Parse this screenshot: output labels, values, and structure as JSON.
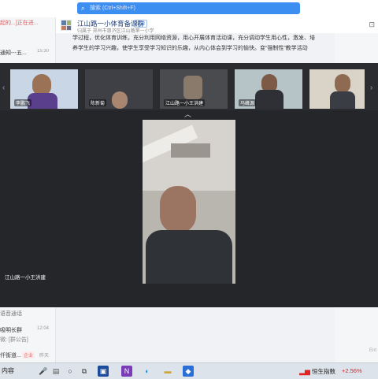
{
  "search": {
    "placeholder": "搜索 (Ctrl+Shift+F)",
    "icon": "search-icon"
  },
  "sidebar": {
    "items": [
      {
        "label": "起的...]正在进...",
        "time": "",
        "color": "#e55b5b"
      },
      {
        "label": "",
        "time": ""
      },
      {
        "label": "通知---五...",
        "time": "15:30"
      }
    ],
    "lower_items": [
      {
        "label": "语音通话",
        "time": ""
      },
      {
        "label": "吸明长群",
        "time": "12:04"
      },
      {
        "label": "微: [群公告]",
        "time": ""
      },
      {
        "label": "仟街道...",
        "badge": "企业",
        "time": "昨天"
      }
    ]
  },
  "chat_header": {
    "group_name": "江山路一小体育备课群",
    "tag": "内部",
    "subtitle": "归属于 郑州市惠济区江山路第一小学"
  },
  "chat": {
    "lines": [
      "学过程，优化体育训练，充分利用网络资源，用心开展体育活动课，充分调动学生用心性，激发、培",
      "养学生的学习兴趣，使学生享受学习知识的乐趣，从内心体会到学习的愉快。变“强制性”教学活动"
    ]
  },
  "video": {
    "participants": [
      {
        "name": "李鹏飞"
      },
      {
        "name": "陈新菊"
      },
      {
        "name": "江山路一小王洪建"
      },
      {
        "name": "马峰源"
      },
      {
        "name": ""
      }
    ],
    "main_speaker": "江山路一小王洪建"
  },
  "taskbar": {
    "left_text": "内容",
    "stock_name": "恒生指数",
    "stock_change": "+2.56%"
  }
}
